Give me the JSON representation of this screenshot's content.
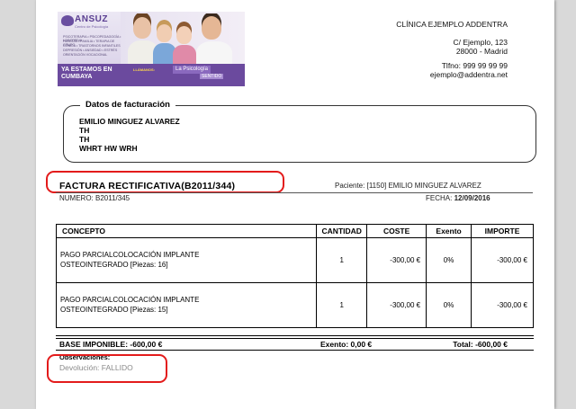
{
  "banner": {
    "logo": "ANSUZ",
    "logo_sub": "Centro de Psicología",
    "services": [
      "PSICOTERAPIA • PSICOPEDAGOGÍA • LOGOPEDIA",
      "PAREJAS • FAMILIA • TERAPIA DE GRUPO",
      "CLÍNICA • TRASTORNOS INFANTILES",
      "DEPRESIÓN • ANSIEDAD • ESTRÉS",
      "ORIENTACIÓN VOCACIONAL"
    ],
    "headline": "YA ESTAMOS EN CUMBAYA",
    "call": "LLÁMANOS:",
    "tag": "La Psicología",
    "tag2": "SENTIDO"
  },
  "clinic": {
    "name": "CLÍNICA EJEMPLO ADDENTRA",
    "street": "C/ Ejemplo, 123",
    "city": "28000 - Madrid",
    "phone": "Tlfno: 999 99 99 99",
    "email": "ejemplo@addentra.net"
  },
  "billing": {
    "title": "Datos de facturación",
    "lines": [
      "EMILIO MINGUEZ ALVAREZ",
      "TH",
      "TH",
      "WHRT HW WRH"
    ]
  },
  "invoice": {
    "title": "FACTURA RECTIFICATIVA(B2011/344)",
    "patient_label": "Paciente:",
    "patient_value": "[1150] EMILIO MINGUEZ ALVAREZ",
    "number_label": "NUMERO:",
    "number_value": "B2011/345",
    "date_label": "FECHA:",
    "date_value": "12/09/2016"
  },
  "table": {
    "headers": [
      "CONCEPTO",
      "CANTIDAD",
      "COSTE",
      "Exento",
      "IMPORTE"
    ],
    "rows": [
      {
        "concepto_1": "PAGO PARCIALCOLOCACIÓN IMPLANTE",
        "concepto_2": "OSTEOINTEGRADO [Piezas:  16]",
        "cantidad": "1",
        "coste": "-300,00 €",
        "exento": "0%",
        "importe": "-300,00 €"
      },
      {
        "concepto_1": "PAGO PARCIALCOLOCACIÓN IMPLANTE",
        "concepto_2": "OSTEOINTEGRADO [Piezas:  15]",
        "cantidad": "1",
        "coste": "-300,00 €",
        "exento": "0%",
        "importe": "-300,00 €"
      }
    ]
  },
  "totals": {
    "base": "BASE IMPONIBLE: -600,00 €",
    "exento": "Exento: 0,00 €",
    "total": "Total: -600,00 €"
  },
  "observations": {
    "label": "Observaciones:",
    "value": "Devolución: FALLIDO"
  },
  "colors": {
    "highlight": "#e31b1b",
    "brand": "#6b4a9e"
  }
}
